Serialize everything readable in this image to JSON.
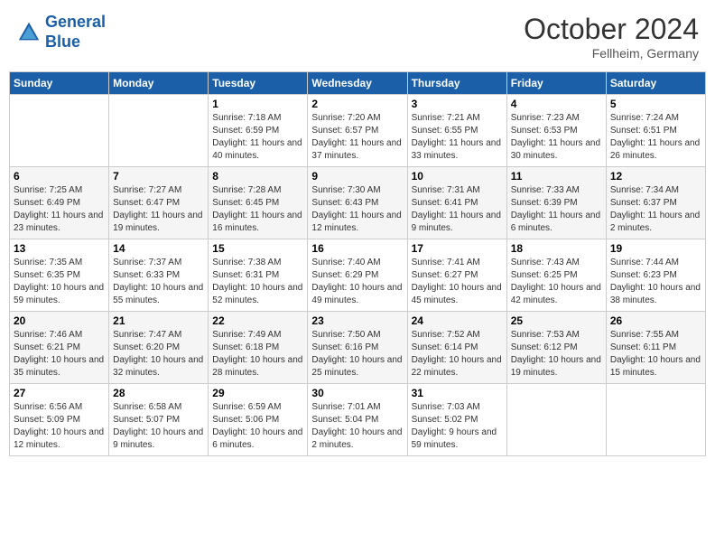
{
  "header": {
    "logo_line1": "General",
    "logo_line2": "Blue",
    "month": "October 2024",
    "location": "Fellheim, Germany"
  },
  "days_of_week": [
    "Sunday",
    "Monday",
    "Tuesday",
    "Wednesday",
    "Thursday",
    "Friday",
    "Saturday"
  ],
  "weeks": [
    [
      {
        "day": "",
        "info": ""
      },
      {
        "day": "",
        "info": ""
      },
      {
        "day": "1",
        "info": "Sunrise: 7:18 AM\nSunset: 6:59 PM\nDaylight: 11 hours and 40 minutes."
      },
      {
        "day": "2",
        "info": "Sunrise: 7:20 AM\nSunset: 6:57 PM\nDaylight: 11 hours and 37 minutes."
      },
      {
        "day": "3",
        "info": "Sunrise: 7:21 AM\nSunset: 6:55 PM\nDaylight: 11 hours and 33 minutes."
      },
      {
        "day": "4",
        "info": "Sunrise: 7:23 AM\nSunset: 6:53 PM\nDaylight: 11 hours and 30 minutes."
      },
      {
        "day": "5",
        "info": "Sunrise: 7:24 AM\nSunset: 6:51 PM\nDaylight: 11 hours and 26 minutes."
      }
    ],
    [
      {
        "day": "6",
        "info": "Sunrise: 7:25 AM\nSunset: 6:49 PM\nDaylight: 11 hours and 23 minutes."
      },
      {
        "day": "7",
        "info": "Sunrise: 7:27 AM\nSunset: 6:47 PM\nDaylight: 11 hours and 19 minutes."
      },
      {
        "day": "8",
        "info": "Sunrise: 7:28 AM\nSunset: 6:45 PM\nDaylight: 11 hours and 16 minutes."
      },
      {
        "day": "9",
        "info": "Sunrise: 7:30 AM\nSunset: 6:43 PM\nDaylight: 11 hours and 12 minutes."
      },
      {
        "day": "10",
        "info": "Sunrise: 7:31 AM\nSunset: 6:41 PM\nDaylight: 11 hours and 9 minutes."
      },
      {
        "day": "11",
        "info": "Sunrise: 7:33 AM\nSunset: 6:39 PM\nDaylight: 11 hours and 6 minutes."
      },
      {
        "day": "12",
        "info": "Sunrise: 7:34 AM\nSunset: 6:37 PM\nDaylight: 11 hours and 2 minutes."
      }
    ],
    [
      {
        "day": "13",
        "info": "Sunrise: 7:35 AM\nSunset: 6:35 PM\nDaylight: 10 hours and 59 minutes."
      },
      {
        "day": "14",
        "info": "Sunrise: 7:37 AM\nSunset: 6:33 PM\nDaylight: 10 hours and 55 minutes."
      },
      {
        "day": "15",
        "info": "Sunrise: 7:38 AM\nSunset: 6:31 PM\nDaylight: 10 hours and 52 minutes."
      },
      {
        "day": "16",
        "info": "Sunrise: 7:40 AM\nSunset: 6:29 PM\nDaylight: 10 hours and 49 minutes."
      },
      {
        "day": "17",
        "info": "Sunrise: 7:41 AM\nSunset: 6:27 PM\nDaylight: 10 hours and 45 minutes."
      },
      {
        "day": "18",
        "info": "Sunrise: 7:43 AM\nSunset: 6:25 PM\nDaylight: 10 hours and 42 minutes."
      },
      {
        "day": "19",
        "info": "Sunrise: 7:44 AM\nSunset: 6:23 PM\nDaylight: 10 hours and 38 minutes."
      }
    ],
    [
      {
        "day": "20",
        "info": "Sunrise: 7:46 AM\nSunset: 6:21 PM\nDaylight: 10 hours and 35 minutes."
      },
      {
        "day": "21",
        "info": "Sunrise: 7:47 AM\nSunset: 6:20 PM\nDaylight: 10 hours and 32 minutes."
      },
      {
        "day": "22",
        "info": "Sunrise: 7:49 AM\nSunset: 6:18 PM\nDaylight: 10 hours and 28 minutes."
      },
      {
        "day": "23",
        "info": "Sunrise: 7:50 AM\nSunset: 6:16 PM\nDaylight: 10 hours and 25 minutes."
      },
      {
        "day": "24",
        "info": "Sunrise: 7:52 AM\nSunset: 6:14 PM\nDaylight: 10 hours and 22 minutes."
      },
      {
        "day": "25",
        "info": "Sunrise: 7:53 AM\nSunset: 6:12 PM\nDaylight: 10 hours and 19 minutes."
      },
      {
        "day": "26",
        "info": "Sunrise: 7:55 AM\nSunset: 6:11 PM\nDaylight: 10 hours and 15 minutes."
      }
    ],
    [
      {
        "day": "27",
        "info": "Sunrise: 6:56 AM\nSunset: 5:09 PM\nDaylight: 10 hours and 12 minutes."
      },
      {
        "day": "28",
        "info": "Sunrise: 6:58 AM\nSunset: 5:07 PM\nDaylight: 10 hours and 9 minutes."
      },
      {
        "day": "29",
        "info": "Sunrise: 6:59 AM\nSunset: 5:06 PM\nDaylight: 10 hours and 6 minutes."
      },
      {
        "day": "30",
        "info": "Sunrise: 7:01 AM\nSunset: 5:04 PM\nDaylight: 10 hours and 2 minutes."
      },
      {
        "day": "31",
        "info": "Sunrise: 7:03 AM\nSunset: 5:02 PM\nDaylight: 9 hours and 59 minutes."
      },
      {
        "day": "",
        "info": ""
      },
      {
        "day": "",
        "info": ""
      }
    ]
  ]
}
